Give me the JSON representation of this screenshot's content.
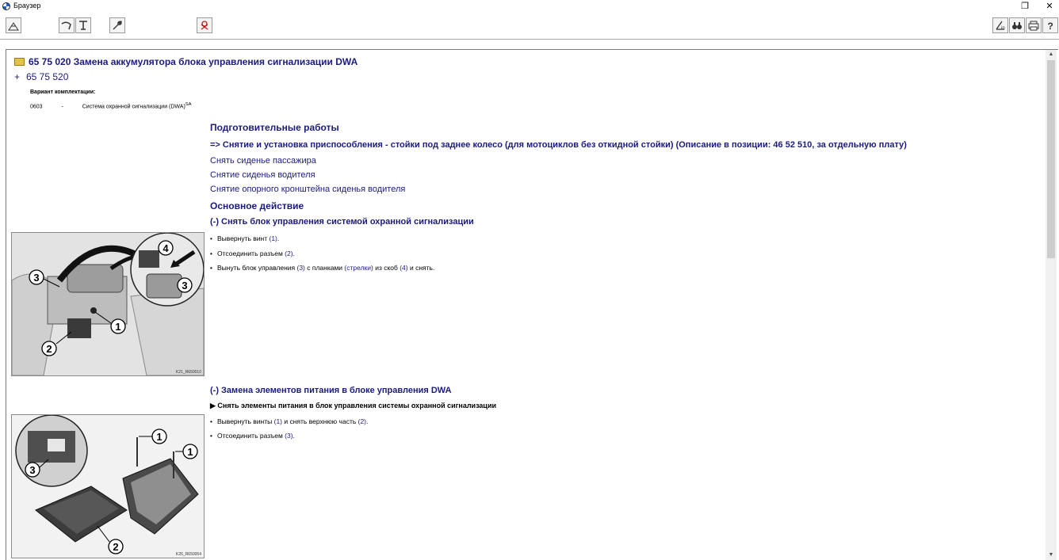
{
  "window": {
    "title": "Браузер",
    "restore_glyph": "❐",
    "close_glyph": "✕"
  },
  "toolbar": {
    "left_icons": [
      "home-icon",
      "bookmark-icon",
      "document-filter-icon",
      "wrench-icon",
      "logout-icon"
    ],
    "right_icons": [
      "bookmark-in-icon",
      "binoculars-icon",
      "print-icon",
      "help-icon"
    ]
  },
  "document": {
    "title": "65 75 020 Замена аккумулятора блока управления сигнализации DWA",
    "plus_sign": "+",
    "related_number": "65 75 520",
    "variant_label": "Вариант комплектации:",
    "variant": {
      "code": "0603",
      "dash": "-",
      "text": "Система охранной сигнализации (DWA)",
      "sup": "SA"
    },
    "prep_heading": "Подготовительные работы",
    "prep_main": "=> Снятие и установка приспособления - стойки под заднее колесо (для мотоциклов без откидной стойки) (Описание в позиции: 46 52 510, за отдельную плату)",
    "prep_links": [
      "Снять сиденье пассажира",
      "Снятие сиденья водителя",
      "Снятие опорного кронштейна сиденья водителя"
    ],
    "main_heading": "Основное действие",
    "section1": {
      "title": "(-) Снять блок управления системой охранной сигнализации",
      "steps": [
        {
          "text": "Вывернуть винт ",
          "refs": "(1)",
          "tail": "."
        },
        {
          "text": "Отсоединить разъем ",
          "refs": "(2)",
          "tail": "."
        },
        {
          "t1": "Вынуть блок управления ",
          "r1": "(3)",
          "t2": " с планками ",
          "r2": "(стрелки)",
          "t3": " из скоб ",
          "r3": "(4)",
          "t4": " и снять."
        }
      ],
      "image_code": "K21_R650010"
    },
    "section2": {
      "title": "(-) Замена элементов питания в блоке управления DWA",
      "action": "▶ Снять элементы питания в блок управления системы охранной сигнализации",
      "steps": [
        {
          "t1": "Вывернуть винты ",
          "r1": "(1)",
          "t2": " и снять верхнюю часть ",
          "r2": "(2)",
          "t3": "."
        },
        {
          "t1": "Отсоединить разъем ",
          "r1": "(3)",
          "t2": "."
        }
      ],
      "image_code": "K26_R650054"
    },
    "callouts": {
      "img1": [
        "1",
        "2",
        "3",
        "3",
        "4"
      ],
      "img2": [
        "1",
        "1",
        "2",
        "3"
      ]
    },
    "bullet": "•"
  },
  "scrollbar": {
    "up_glyph": "▲",
    "down_glyph": "▼"
  }
}
